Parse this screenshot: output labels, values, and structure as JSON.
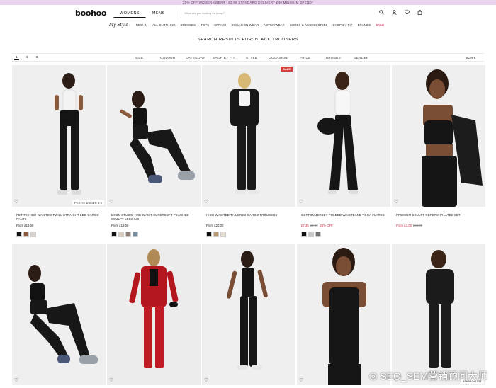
{
  "promo": "20% OFF WOMENSWEAR · £3.99 STANDARD DELIVERY £40 MINIMUM SPEND*",
  "nav": {
    "logo": "boohoo",
    "tabs": [
      "WOMENS",
      "MENS"
    ],
    "search_placeholder": "What are you looking for today?",
    "icons": [
      "search-icon",
      "account-icon",
      "wishlist-icon",
      "bag-icon"
    ]
  },
  "subnav": {
    "brand": "My Style",
    "links": [
      "NEW IN",
      "ALL CLOTHING",
      "DRESSES",
      "TOPS",
      "SPRING",
      "OCCASION WEAR",
      "ACTIVEWEAR",
      "SHOES & ACCESSORIES",
      "SHOP BY FIT",
      "BRANDS"
    ],
    "sale": "SALE"
  },
  "results_title": "SEARCH RESULTS FOR: BLACK TROUSERS",
  "grid_options": [
    "1",
    "4",
    "8"
  ],
  "filters": [
    "SIZE",
    "COLOUR",
    "CATEGORY",
    "SHOP BY FIT",
    "STYLE",
    "OCCASION",
    "PRICE",
    "BRANDS",
    "GENDER"
  ],
  "sort_label": "SORT",
  "products": [
    {
      "name": "PETITE HIGH WAISTED TWILL STRAIGHT LEG CARGO PANTS",
      "price": "From £18.00",
      "badge": "PETITE UNDER 5'3",
      "swatches": [
        "#111111",
        "#8a5a3c",
        "#d9d4cf"
      ]
    },
    {
      "name": "DSGN STUDIO HIGHWAIST SUPERSOFT PEACHED SCULPT LEGGING",
      "price": "From £19.00",
      "swatches": [
        "#111111",
        "#d8cbbf",
        "#8e8079",
        "#7a8fa0"
      ]
    },
    {
      "name": "HIGH WAISTED TAILORED CARGO TROUSERS",
      "price": "From £20.00",
      "sale": "SALE",
      "swatches": [
        "#111111",
        "#b59a74",
        "#e6ddd3"
      ]
    },
    {
      "name": "COTTON JERSEY FOLDED WAISTBAND YOGA FLARES",
      "price_now": "£7.35",
      "price_was": "£8.00",
      "price_off": "25% OFF",
      "swatches": [
        "#111111",
        "#c9c9c9",
        "#6d6d6d"
      ]
    },
    {
      "name": "PREMIUM SCULPT REFORM PILATES SET",
      "price_now": "From £7.00",
      "price_was": "£60.00"
    },
    {
      "badge": ""
    },
    {
      "badge": ""
    },
    {
      "badge": ""
    },
    {
      "badge": ""
    },
    {
      "badge": "BOOHOO FIT"
    }
  ],
  "watermark": "SEO_SEM营销顾问大师"
}
